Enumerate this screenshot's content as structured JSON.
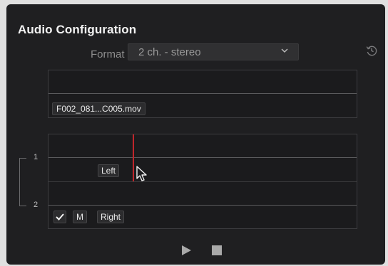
{
  "panel": {
    "title": "Audio Configuration"
  },
  "format": {
    "label": "Format",
    "value": "2 ch. - stereo"
  },
  "clip": {
    "name": "F002_081...C005.mov"
  },
  "channels": {
    "numbers": [
      "1",
      "2"
    ],
    "left_label": "Left",
    "right_label": "Right",
    "mute_label": "M",
    "checkbox_checked": true
  },
  "icons": {
    "reset": "reset-history-icon",
    "chevron": "chevron-down-icon",
    "check": "checkmark-icon",
    "play": "play-icon",
    "stop": "stop-icon",
    "cursor": "pointer-cursor-icon"
  },
  "colors": {
    "panel_bg": "#1f1f21",
    "playhead": "#c0262b",
    "text": "#f2f2f2",
    "muted_text": "#8e8e8e"
  }
}
